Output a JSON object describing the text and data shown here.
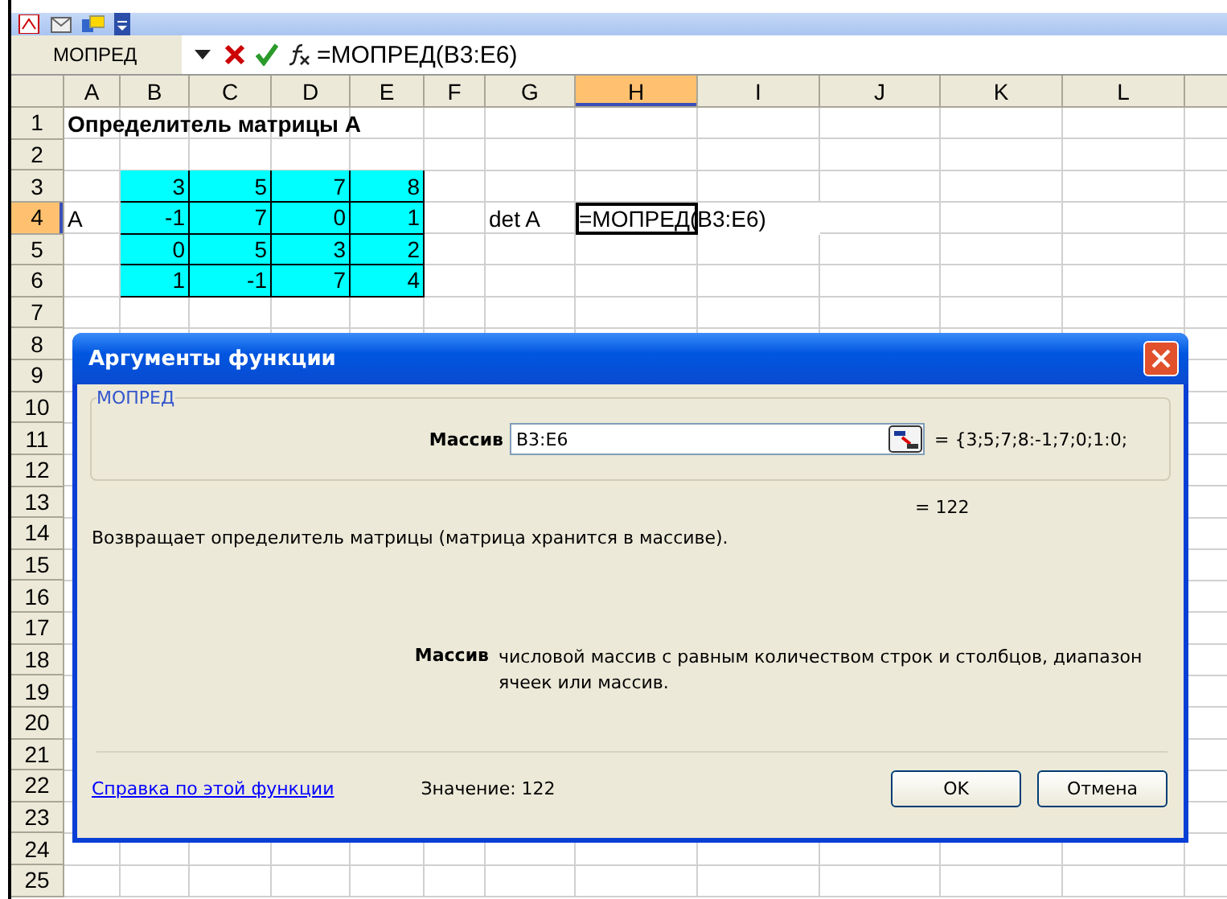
{
  "formula_bar": {
    "name_box": "МОПРЕД",
    "formula": "=МОПРЕД(B3:E6)"
  },
  "columns": [
    {
      "label": "A",
      "selected": false
    },
    {
      "label": "B",
      "selected": false
    },
    {
      "label": "C",
      "selected": false
    },
    {
      "label": "D",
      "selected": false
    },
    {
      "label": "E",
      "selected": false
    },
    {
      "label": "F",
      "selected": false
    },
    {
      "label": "G",
      "selected": false
    },
    {
      "label": "H",
      "selected": true
    },
    {
      "label": "I",
      "selected": false
    },
    {
      "label": "J",
      "selected": false
    },
    {
      "label": "K",
      "selected": false
    },
    {
      "label": "L",
      "selected": false
    }
  ],
  "rows": [
    {
      "number": "1",
      "selected": false,
      "cells": [
        {
          "kind": "title",
          "text": "Определитель матрицы А"
        }
      ]
    },
    {
      "number": "2",
      "selected": false,
      "cells": []
    },
    {
      "number": "3",
      "selected": false,
      "cells": [
        {
          "kind": "empty"
        },
        {
          "kind": "matrix",
          "text": "3"
        },
        {
          "kind": "matrix",
          "text": "5"
        },
        {
          "kind": "matrix",
          "text": "7"
        },
        {
          "kind": "matrix",
          "text": "8"
        }
      ]
    },
    {
      "number": "4",
      "selected": true,
      "cells": [
        {
          "kind": "label",
          "text": "A"
        },
        {
          "kind": "matrix",
          "text": "-1"
        },
        {
          "kind": "matrix",
          "text": "7"
        },
        {
          "kind": "matrix",
          "text": "0"
        },
        {
          "kind": "matrix",
          "text": "1"
        },
        {
          "kind": "empty"
        },
        {
          "kind": "label",
          "text": "det A"
        },
        {
          "kind": "active",
          "text": "=МОПРЕД(B3:E6)"
        }
      ]
    },
    {
      "number": "5",
      "selected": false,
      "cells": [
        {
          "kind": "empty"
        },
        {
          "kind": "matrix",
          "text": "0"
        },
        {
          "kind": "matrix",
          "text": "5"
        },
        {
          "kind": "matrix",
          "text": "3"
        },
        {
          "kind": "matrix",
          "text": "2"
        }
      ]
    },
    {
      "number": "6",
      "selected": false,
      "cells": [
        {
          "kind": "empty"
        },
        {
          "kind": "matrix",
          "text": "1"
        },
        {
          "kind": "matrix",
          "text": "-1"
        },
        {
          "kind": "matrix",
          "text": "7"
        },
        {
          "kind": "matrix",
          "text": "4"
        }
      ]
    },
    {
      "number": "7",
      "selected": false,
      "cells": []
    },
    {
      "number": "8",
      "selected": false,
      "cells": []
    },
    {
      "number": "9",
      "selected": false,
      "cells": []
    },
    {
      "number": "10",
      "selected": false,
      "cells": []
    },
    {
      "number": "11",
      "selected": false,
      "cells": []
    },
    {
      "number": "12",
      "selected": false,
      "cells": []
    },
    {
      "number": "13",
      "selected": false,
      "cells": []
    },
    {
      "number": "14",
      "selected": false,
      "cells": []
    },
    {
      "number": "15",
      "selected": false,
      "cells": []
    },
    {
      "number": "16",
      "selected": false,
      "cells": []
    },
    {
      "number": "17",
      "selected": false,
      "cells": []
    },
    {
      "number": "18",
      "selected": false,
      "cells": []
    },
    {
      "number": "19",
      "selected": false,
      "cells": []
    },
    {
      "number": "20",
      "selected": false,
      "cells": []
    },
    {
      "number": "21",
      "selected": false,
      "cells": []
    },
    {
      "number": "22",
      "selected": false,
      "cells": []
    },
    {
      "number": "23",
      "selected": false,
      "cells": []
    },
    {
      "number": "24",
      "selected": false,
      "cells": []
    },
    {
      "number": "25",
      "selected": false,
      "cells": []
    }
  ],
  "dialog": {
    "title": "Аргументы функции",
    "group": "МОПРЕД",
    "argument": {
      "label": "Массив",
      "value": "B3:E6",
      "result": "= {3;5;7;8:-1;7;0;1:0;"
    },
    "total": "= 122",
    "description": "Возвращает определитель матрицы (матрица хранится в массиве).",
    "help_label": "Массив",
    "help_text": "числовой массив с равным количеством строк и столбцов, диапазон ячеек или массив.",
    "help_link": "Справка по этой функции",
    "value": "Значение: 122",
    "buttons": [
      "OK",
      "Отмена"
    ]
  }
}
